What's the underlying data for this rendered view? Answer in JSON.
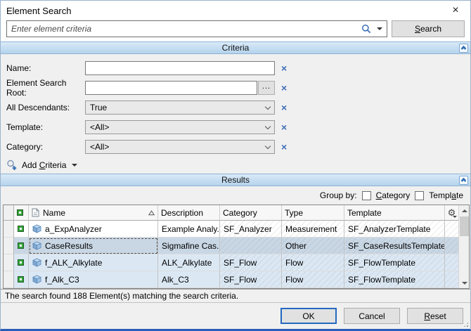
{
  "window": {
    "title": "Element Search",
    "close_glyph": "×"
  },
  "search": {
    "placeholder": "Enter element criteria",
    "button": {
      "pre": "",
      "key": "S",
      "post": "earch"
    }
  },
  "criteria": {
    "header": "Criteria",
    "fields": [
      {
        "label": "Name:",
        "value": ""
      },
      {
        "label": "Element Search Root:",
        "value": "",
        "browse": "..."
      },
      {
        "label": "All Descendants:",
        "value": "True"
      },
      {
        "label": "Template:",
        "value": "<All>"
      },
      {
        "label": "Category:",
        "value": "<All>"
      }
    ],
    "clear_glyph": "×",
    "add_criteria": {
      "pre": "Add ",
      "key": "C",
      "post": "riteria"
    }
  },
  "results": {
    "header": "Results",
    "group_by_label": "Group by:",
    "group_by": [
      {
        "pre": "",
        "key": "C",
        "post": "ategory",
        "checked": false
      },
      {
        "pre": "Templ",
        "key": "a",
        "post": "te",
        "checked": false
      }
    ],
    "columns": [
      "Name",
      "Description",
      "Category",
      "Type",
      "Template"
    ],
    "rows": [
      {
        "name": "a_ExpAnalyzer",
        "description": "Example Analy...",
        "category": "SF_Analyzer",
        "type": "Measurement",
        "template": "SF_AnalyzerTemplate",
        "selected": false,
        "alt": false
      },
      {
        "name": "CaseResults",
        "description": "Sigmafine Cas...",
        "category": "",
        "type": "Other",
        "template": "SF_CaseResultsTemplate",
        "selected": true,
        "alt": false
      },
      {
        "name": "f_ALK_Alkylate",
        "description": "ALK_Alkylate",
        "category": "SF_Flow",
        "type": "Flow",
        "template": "SF_FlowTemplate",
        "selected": false,
        "alt": true
      },
      {
        "name": "f_Alk_C3",
        "description": "Alk_C3",
        "category": "SF_Flow",
        "type": "Flow",
        "template": "SF_FlowTemplate",
        "selected": false,
        "alt": true
      }
    ],
    "gear_glyph": "⚙",
    "status": "The search found 188 Element(s) matching the search criteria."
  },
  "footer": {
    "ok": "OK",
    "cancel": "Cancel",
    "reset": {
      "pre": "",
      "key": "R",
      "post": "eset"
    }
  },
  "colors": {
    "accent_border": "#2b5cb8",
    "section_header_top": "#d9eaf8",
    "section_header_bottom": "#b5d3ec",
    "selected_row": "#c9d7e5",
    "alt_row": "#dbe8f4",
    "clear_x": "#3f6fb8"
  }
}
